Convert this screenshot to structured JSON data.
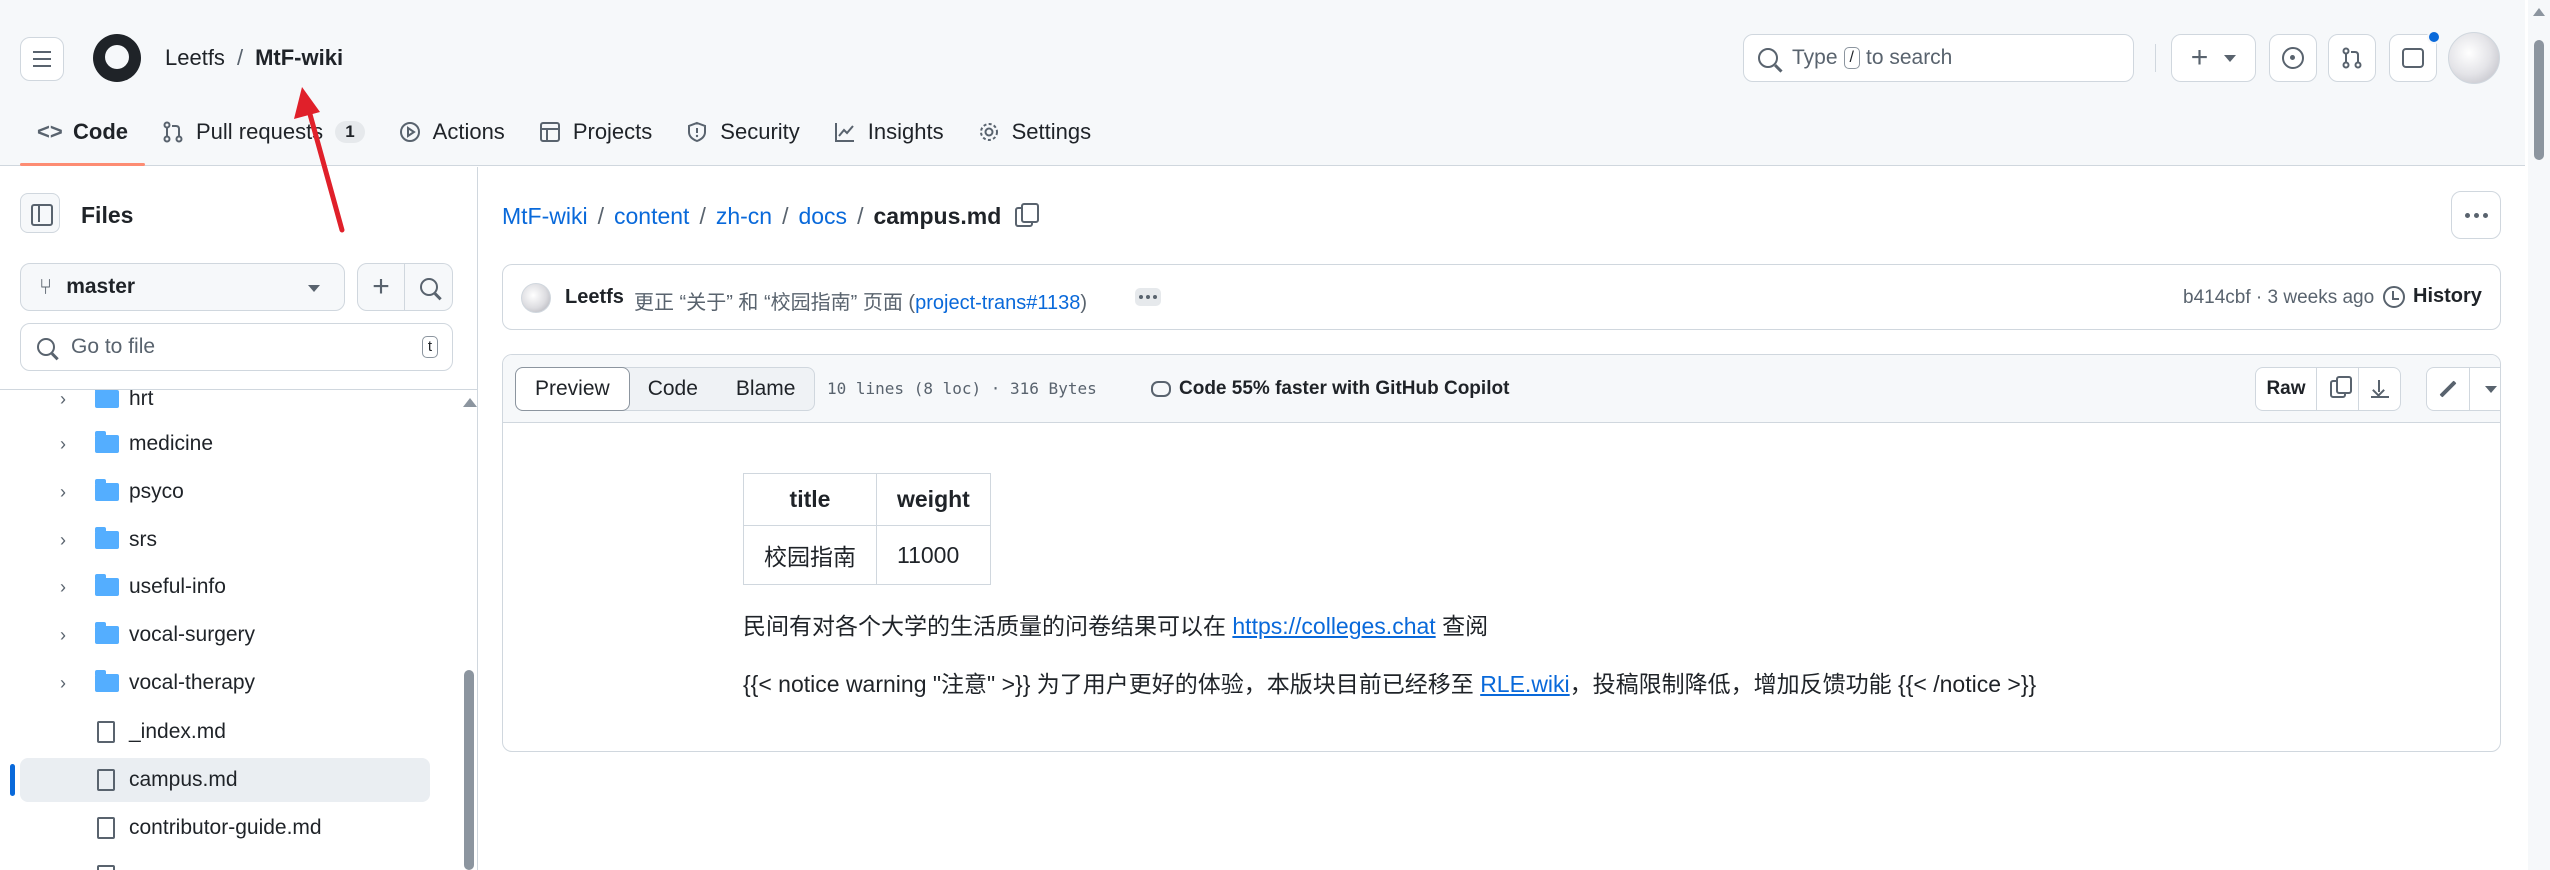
{
  "header": {
    "owner": "Leetfs",
    "separator": "/",
    "repo": "MtF-wiki",
    "search": {
      "prefix": "Type",
      "key": "/",
      "suffix": "to search"
    }
  },
  "nav": {
    "tabs": [
      {
        "label": "Code",
        "icon": "code-icon",
        "active": true
      },
      {
        "label": "Pull requests",
        "icon": "pull-request-icon",
        "count": "1"
      },
      {
        "label": "Actions",
        "icon": "play-icon"
      },
      {
        "label": "Projects",
        "icon": "table-icon"
      },
      {
        "label": "Security",
        "icon": "shield-icon"
      },
      {
        "label": "Insights",
        "icon": "graph-icon"
      },
      {
        "label": "Settings",
        "icon": "gear-icon"
      }
    ]
  },
  "sidebar": {
    "title": "Files",
    "branch": "master",
    "goto_placeholder": "Go to file",
    "goto_key": "t",
    "tree": [
      {
        "type": "folder",
        "label": "hrt"
      },
      {
        "type": "folder",
        "label": "medicine"
      },
      {
        "type": "folder",
        "label": "psyco"
      },
      {
        "type": "folder",
        "label": "srs"
      },
      {
        "type": "folder",
        "label": "useful-info"
      },
      {
        "type": "folder",
        "label": "vocal-surgery"
      },
      {
        "type": "folder",
        "label": "vocal-therapy"
      },
      {
        "type": "file",
        "label": "_index.md"
      },
      {
        "type": "file",
        "label": "campus.md",
        "selected": true
      },
      {
        "type": "file",
        "label": "contributor-guide.md"
      }
    ]
  },
  "breadcrumb": {
    "parts": [
      "MtF-wiki",
      "content",
      "zh-cn",
      "docs"
    ],
    "current": "campus.md"
  },
  "commit": {
    "author": "Leetfs",
    "message": "更正 “关于” 和 “校园指南” 页面 (",
    "pr_link": "project-trans#1138",
    "message_end": ")",
    "meta": "b414cbf · 3 weeks ago",
    "history_label": "History"
  },
  "file": {
    "views": [
      "Preview",
      "Code",
      "Blame"
    ],
    "active_view": "Preview",
    "stats": "10 lines (8 loc) · 316 Bytes",
    "copilot": "Code 55% faster with GitHub Copilot",
    "raw_label": "Raw"
  },
  "markdown": {
    "table": {
      "headers": [
        "title",
        "weight"
      ],
      "rows": [
        [
          "校园指南",
          "11000"
        ]
      ]
    },
    "p1_text": "民间有对各个大学的生活质量的问卷结果可以在 ",
    "p1_link": "https://colleges.chat",
    "p1_end": " 查阅",
    "p2_text": "{{< notice warning \"注意\" >}} 为了用户更好的体验，本版块目前已经移至 ",
    "p2_link": "RLE.wiki",
    "p2_end": "，投稿限制降低，增加反馈功能 {{< /notice >}}"
  },
  "colors": {
    "accent": "#0969da",
    "tab_underline": "#fd8c73",
    "annotation_arrow": "#e0202a",
    "folder": "#54aeff"
  }
}
